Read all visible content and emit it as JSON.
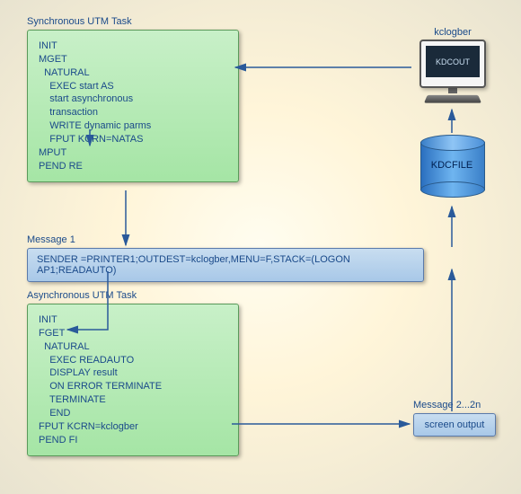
{
  "sync_task": {
    "title": "Synchronous UTM Task",
    "lines": [
      "INIT",
      "MGET",
      "  NATURAL",
      "    EXEC start AS",
      "    start asynchronous",
      "    transaction",
      "    WRITE dynamic parms",
      "",
      "    FPUT KCRN=NATAS",
      "MPUT",
      "PEND RE"
    ]
  },
  "message1": {
    "title": "Message 1",
    "text": "SENDER =PRINTER1;OUTDEST=kclogber,MENU=F,STACK=(LOGON AP1;READAUTO)"
  },
  "async_task": {
    "title": "Asynchronous UTM Task",
    "lines": [
      "INIT",
      "FGET",
      "  NATURAL",
      "    EXEC READAUTO",
      "    DISPLAY result",
      "    ON ERROR TERMINATE",
      "    TERMINATE",
      "    END",
      "FPUT KCRN=kclogber",
      "PEND FI"
    ]
  },
  "message2": {
    "title": "Message 2...2n",
    "text": "screen output"
  },
  "kdcfile": {
    "label": "KDCFILE"
  },
  "computer": {
    "label": "kclogber",
    "screen_text": "KDCOUT"
  }
}
